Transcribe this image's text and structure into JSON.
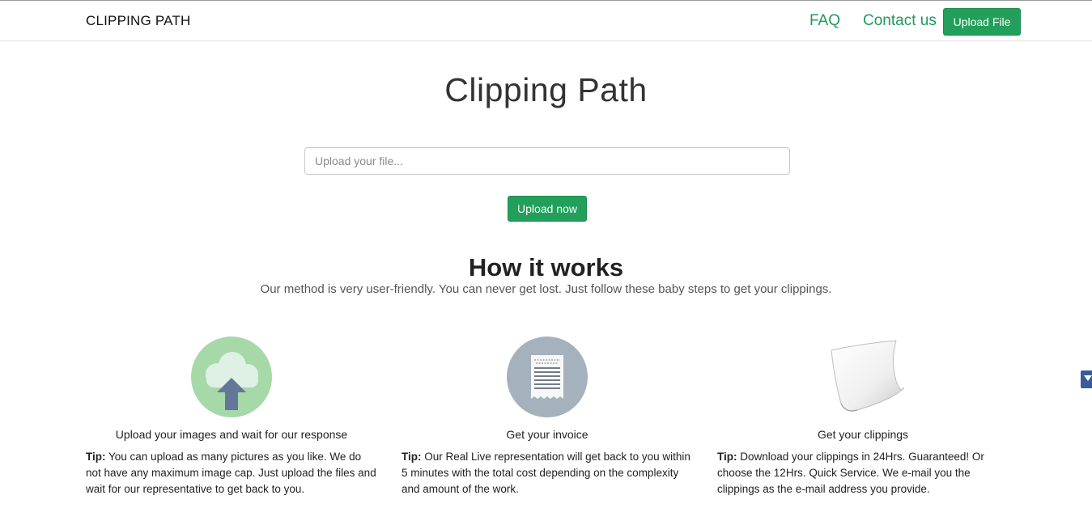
{
  "navbar": {
    "brand": "CLIPPING PATH",
    "links": [
      "FAQ",
      "Contact us"
    ],
    "upload_button": "Upload File"
  },
  "hero": {
    "title": "Clipping Path",
    "input_placeholder": "Upload your file...",
    "upload_button": "Upload now"
  },
  "how_it_works": {
    "title": "How it works",
    "subtitle": "Our method is very user-friendly. You can never get lost. Just follow these baby steps to get your clippings.",
    "steps": [
      {
        "icon": "cloud-upload-icon",
        "caption": "Upload your images and wait for our response",
        "tip_label": "Tip:",
        "tip_text": " You can upload as many pictures as you like. We do not have any maximum image cap. Just upload the files and wait for our representative to get back to you."
      },
      {
        "icon": "receipt-icon",
        "caption": "Get your invoice",
        "tip_label": "Tip:",
        "tip_text": " Our Real Live representation will get back to you within 5 minutes with the total cost depending on the complexity and amount of the work."
      },
      {
        "icon": "paper-icon",
        "caption": "Get your clippings",
        "tip_label": "Tip:",
        "tip_text": " Download your clippings in 24Hrs. Guaranteed! Or choose the 12Hrs. Quick Service. We e-mail you the clippings as the e-mail address you provide."
      }
    ]
  },
  "colors": {
    "accent_green": "#22a05b",
    "link_green": "#21995a",
    "cloud_circle": "#a7d9a8",
    "receipt_circle": "#a5b1bc",
    "arrow_blue": "#63779a",
    "side_tab": "#3a5b9a"
  }
}
